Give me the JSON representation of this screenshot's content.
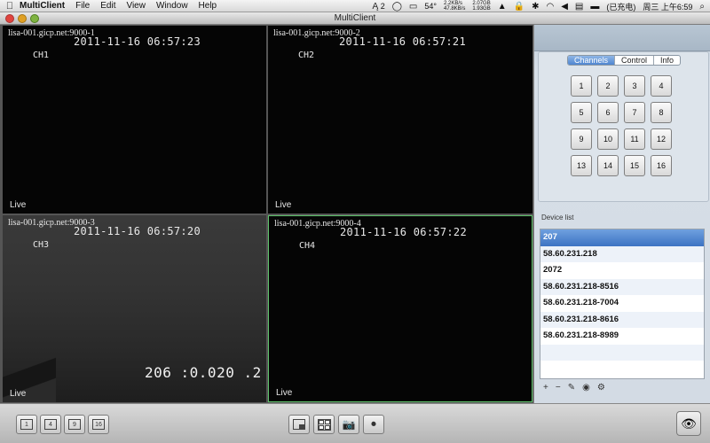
{
  "menubar": {
    "app_name": "MultiClient",
    "menus": [
      "File",
      "Edit",
      "View",
      "Window",
      "Help"
    ],
    "status": {
      "adobe_count": "2",
      "temperature": "54°",
      "net_up": "2.2KB/s",
      "net_down": "47.8KB/s",
      "mem_used": "2.07GB",
      "mem_free": "1.93GB",
      "battery": "(已充电)",
      "clock": "周三 上午6:59"
    }
  },
  "window": {
    "title": "MultiClient"
  },
  "cameras": [
    {
      "host": "lisa-001.gicp.net:9000-1",
      "timestamp": "2011-11-16 06:57:23",
      "channel": "CH1",
      "status": "Live"
    },
    {
      "host": "lisa-001.gicp.net:9000-2",
      "timestamp": "2011-11-16 06:57:21",
      "channel": "CH2",
      "status": "Live"
    },
    {
      "host": "lisa-001.gicp.net:9000-3",
      "timestamp": "2011-11-16 06:57:20",
      "channel": "CH3",
      "status": "Live",
      "overlay": "206 :0.020 .2"
    },
    {
      "host": "lisa-001.gicp.net:9000-4",
      "timestamp": "2011-11-16 06:57:22",
      "channel": "CH4",
      "status": "Live"
    }
  ],
  "panel": {
    "tabs": [
      "Channels",
      "Control",
      "Info"
    ],
    "active_tab": "Channels",
    "channel_buttons": [
      "1",
      "2",
      "3",
      "4",
      "5",
      "6",
      "7",
      "8",
      "9",
      "10",
      "11",
      "12",
      "13",
      "14",
      "15",
      "16"
    ],
    "device_list_label": "Device list",
    "devices": [
      "207",
      "58.60.231.218",
      "2072",
      "58.60.231.218-8516",
      "58.60.231.218-7004",
      "58.60.231.218-8616",
      "58.60.231.218-8989"
    ],
    "selected_device": "207",
    "device_tools": [
      "+",
      "−",
      "✎",
      "◉",
      "⚙"
    ]
  },
  "toolbar": {
    "layout_buttons": [
      "1",
      "4",
      "9",
      "16"
    ],
    "accent": "#5ec46b"
  }
}
